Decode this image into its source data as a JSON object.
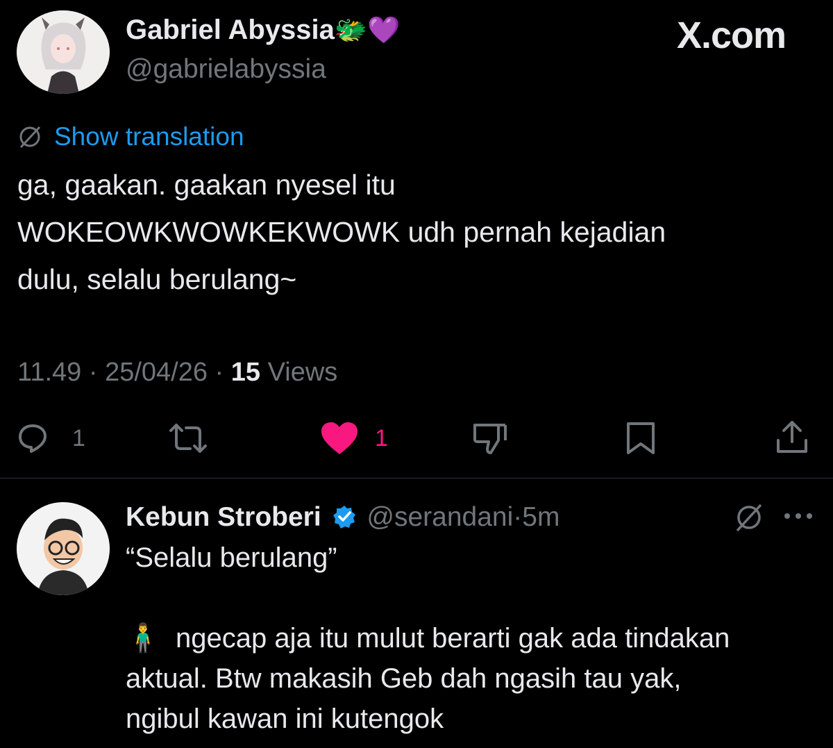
{
  "watermark": "X.com",
  "tweet": {
    "author_name": "Gabriel Abyssia",
    "author_emojis": "🐲💜",
    "handle": "@gabrielabyssia",
    "show_translation": "Show translation",
    "text_lines": [
      "ga, gaakan. gaakan nyesel itu",
      "WOKEOWKWOWKEKWOWK udh pernah kejadian",
      "dulu, selalu berulang~"
    ],
    "time": "11.49",
    "date": "25/04/26",
    "views_count": "15",
    "views_label": "Views",
    "reply_count": "1",
    "like_count": "1",
    "sep": "·"
  },
  "reply": {
    "author_name": "Kebun Stroberi",
    "handle": "@serandani",
    "sep": "·",
    "time": "5m",
    "line1": "“Selalu berulang”",
    "emoji": "🧍‍♂️",
    "line2": "ngecap aja itu mulut berarti gak ada tindakan",
    "line3": "aktual. Btw makasih Geb dah ngasih tau yak,",
    "line4": "ngibul kawan ini kutengok"
  },
  "icons": {
    "translate": "globe-slash-icon",
    "reply": "reply-icon",
    "retweet": "retweet-icon",
    "like": "heart-icon",
    "dislike": "thumbs-down-icon",
    "bookmark": "bookmark-icon",
    "share": "share-icon",
    "verified": "verified-badge-icon",
    "more": "more-icon"
  },
  "colors": {
    "background": "#000000",
    "text": "#e7e9ea",
    "muted": "#71767b",
    "link": "#1d9bf0",
    "like": "#f91880",
    "verified": "#1d9bf0"
  }
}
